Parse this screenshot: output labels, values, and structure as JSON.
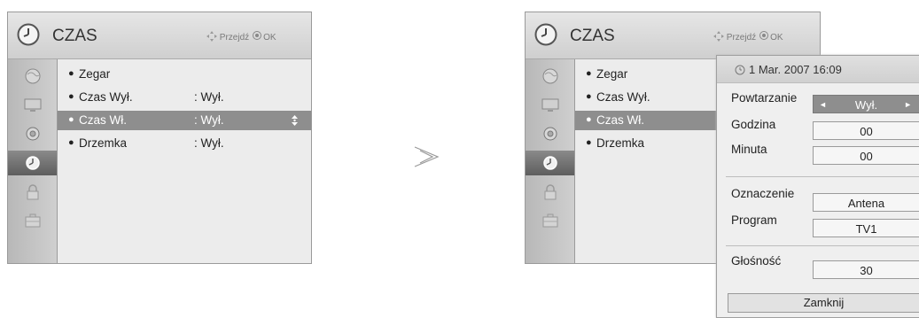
{
  "left_menu": {
    "title": "CZAS",
    "hint_move": "Przejdź",
    "hint_ok": "OK",
    "items": [
      {
        "label": "Zegar",
        "value": ""
      },
      {
        "label": "Czas Wył.",
        "value": ": Wył."
      },
      {
        "label": "Czas Wł.",
        "value": ": Wył."
      },
      {
        "label": "Drzemka",
        "value": ": Wył."
      }
    ]
  },
  "right_menu": {
    "title": "CZAS",
    "hint_move": "Przejdź",
    "hint_ok": "OK",
    "items": [
      {
        "label": "Zegar"
      },
      {
        "label": "Czas Wył."
      },
      {
        "label": "Czas Wł."
      },
      {
        "label": "Drzemka"
      }
    ]
  },
  "sidebar_icons": [
    "globe-icon",
    "tv-screen-icon",
    "speaker-icon",
    "clock-icon",
    "lock-icon",
    "toolbox-icon"
  ],
  "popup": {
    "date": "1 Mar. 2007 16:09",
    "repeat_label": "Powtarzanie",
    "repeat_value": "Wył.",
    "hour_label": "Godzina",
    "hour_value": "00",
    "minute_label": "Minuta",
    "minute_value": "00",
    "input_label": "Oznaczenie",
    "input_value": "Antena",
    "program_label": "Program",
    "program_value": "TV1",
    "volume_label": "Głośność",
    "volume_value": "30",
    "close_label": "Zamknij"
  },
  "colors": {
    "selected_row": "#8e8e8e",
    "active_sidebar": "#5e5e5e",
    "panel_bg": "#ececec"
  }
}
